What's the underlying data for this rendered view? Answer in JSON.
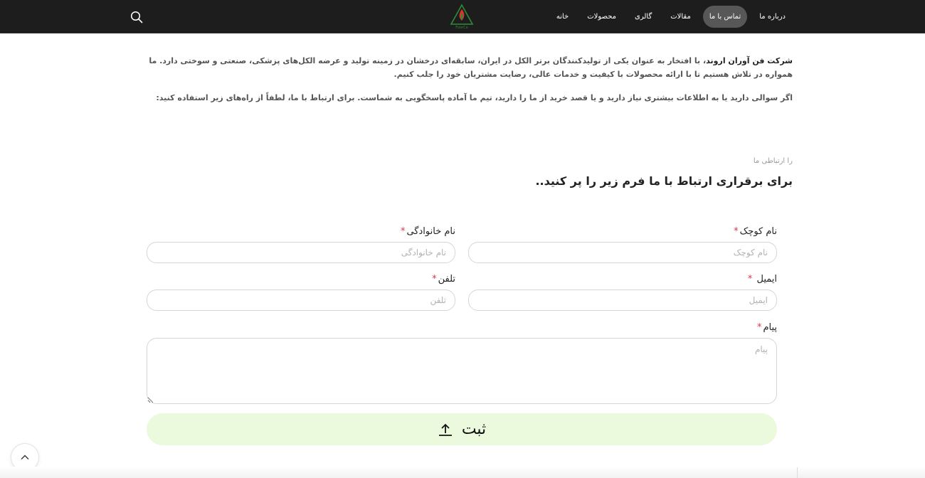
{
  "nav": {
    "items": [
      {
        "label": "خانه",
        "active": false
      },
      {
        "label": "محصولات",
        "active": false
      },
      {
        "label": "گالری",
        "active": false
      },
      {
        "label": "مقالات",
        "active": false
      },
      {
        "label": "تماس با ما",
        "active": true
      },
      {
        "label": "درباره ما",
        "active": false
      }
    ],
    "logo_text": "FoorCo"
  },
  "intro": {
    "company": "شرکت فن آوران اروند",
    "paragraph1_rest": "، با افتخار به عنوان یکی از تولیدکنندگان برتر الکل در ایران، سابقه‌ای درخشان در زمینه تولید و عرضه الکل‌های پزشکی، صنعتی و سوختی دارد. ما همواره در تلاش هستیم تا با ارائه محصولات با کیفیت و خدمات عالی، رضایت مشتریان خود را جلب کنیم.",
    "paragraph2": "اگر سوالی دارید یا به اطلاعات بیشتری نیاز دارید و یا قصد خرید از ما را دارید، تیم ما آماده پاسخگویی به شماست. برای ارتباط با ما، لطفاً از راه‌های زیر استفاده کنید:"
  },
  "form": {
    "eyebrow": "را ارتباطی ما",
    "title": "برای برقراری ارتباط با ما فرم زیر را پر کنید..",
    "required_mark": "*",
    "first_name": {
      "label": "نام کوچک",
      "placeholder": "نام کوچک",
      "value": ""
    },
    "last_name": {
      "label": "نام خانوادگی",
      "placeholder": "نام خانوادگی",
      "value": ""
    },
    "email": {
      "label": "ایمیل",
      "placeholder": "ایمیل",
      "value": ""
    },
    "phone": {
      "label": "تلفن",
      "placeholder": "تلفن",
      "value": ""
    },
    "message": {
      "label": "پیام",
      "placeholder": "پیام",
      "value": ""
    },
    "submit_label": "ثبت"
  },
  "colors": {
    "header_bg": "#1d1d1d",
    "nav_active_bg": "#575757",
    "required": "#e0334d",
    "submit_bg": "#ebfadc",
    "logo_green": "#2e8b3a",
    "logo_red": "#d8352a"
  },
  "icons": {
    "search": "search-icon",
    "submit": "upload-icon",
    "scroll_top": "chevron-up-icon",
    "logo": "flame-triangle-logo"
  }
}
